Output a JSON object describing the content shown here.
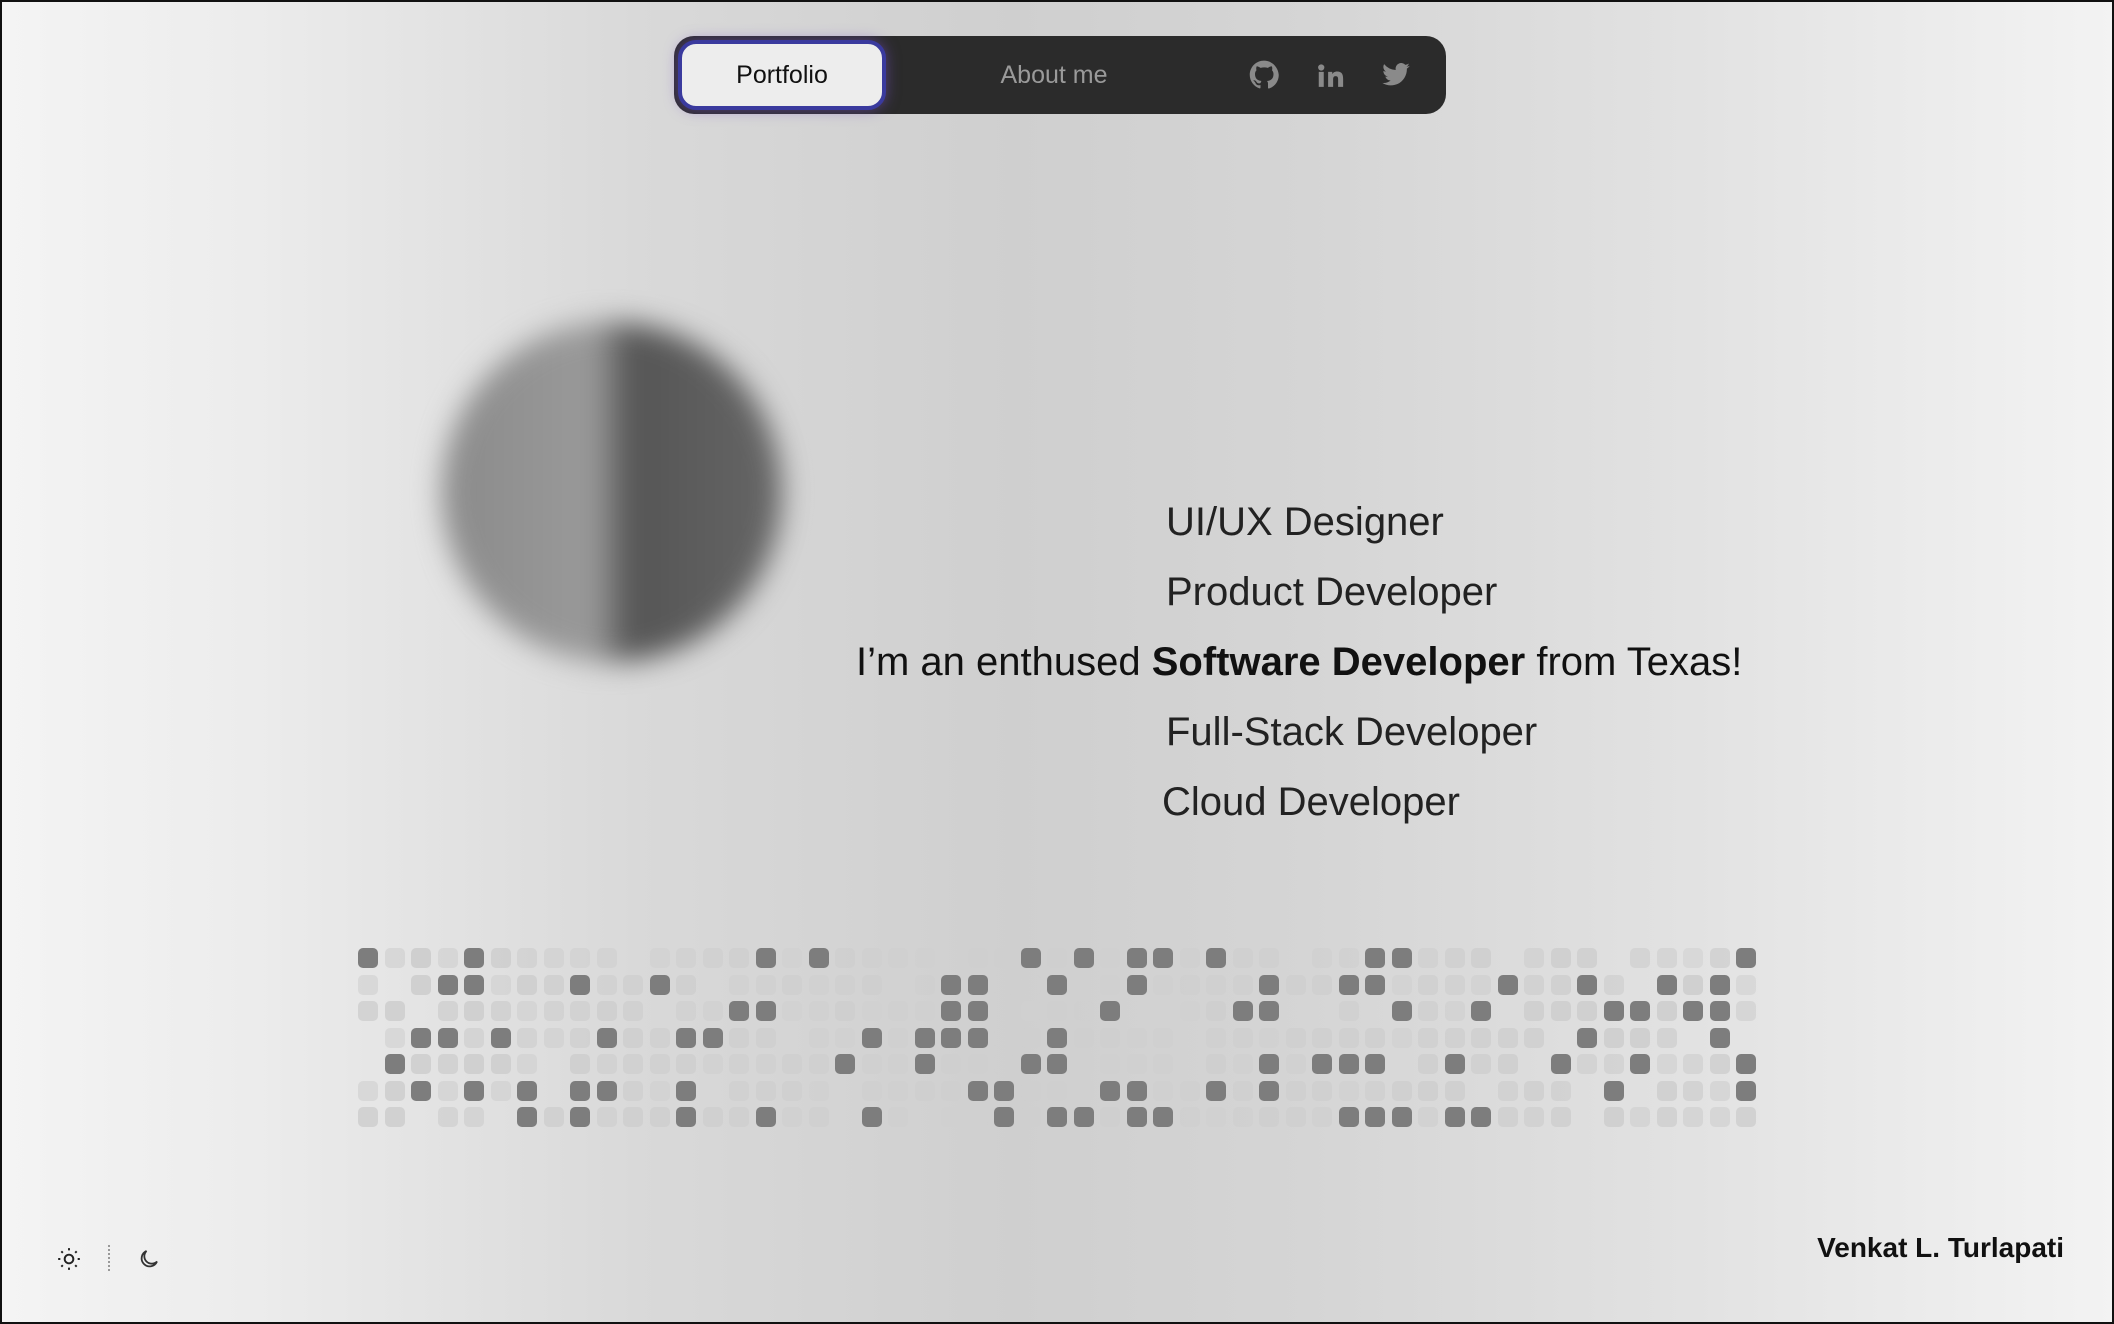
{
  "nav": {
    "portfolio_label": "Portfolio",
    "about_label": "About me",
    "icons": [
      "github-icon",
      "linkedin-icon",
      "twitter-icon"
    ]
  },
  "hero": {
    "roles": [
      "UI/UX Designer",
      "Product Developer",
      "Full-Stack Developer",
      "Cloud Developer"
    ],
    "tagline_prefix": "I’m an enthused ",
    "tagline_highlight": "Software Developer",
    "tagline_suffix": " from Texas!"
  },
  "footer": {
    "author": "Venkat L. Turlapati",
    "theme_icons": [
      "sun-icon",
      "moon-icon"
    ]
  },
  "colors": {
    "nav_bg": "#2b2b2b",
    "active_border": "#3a3a9e",
    "dark_cell": "#7d7d7d",
    "light_cell": "#cfcfcf"
  }
}
